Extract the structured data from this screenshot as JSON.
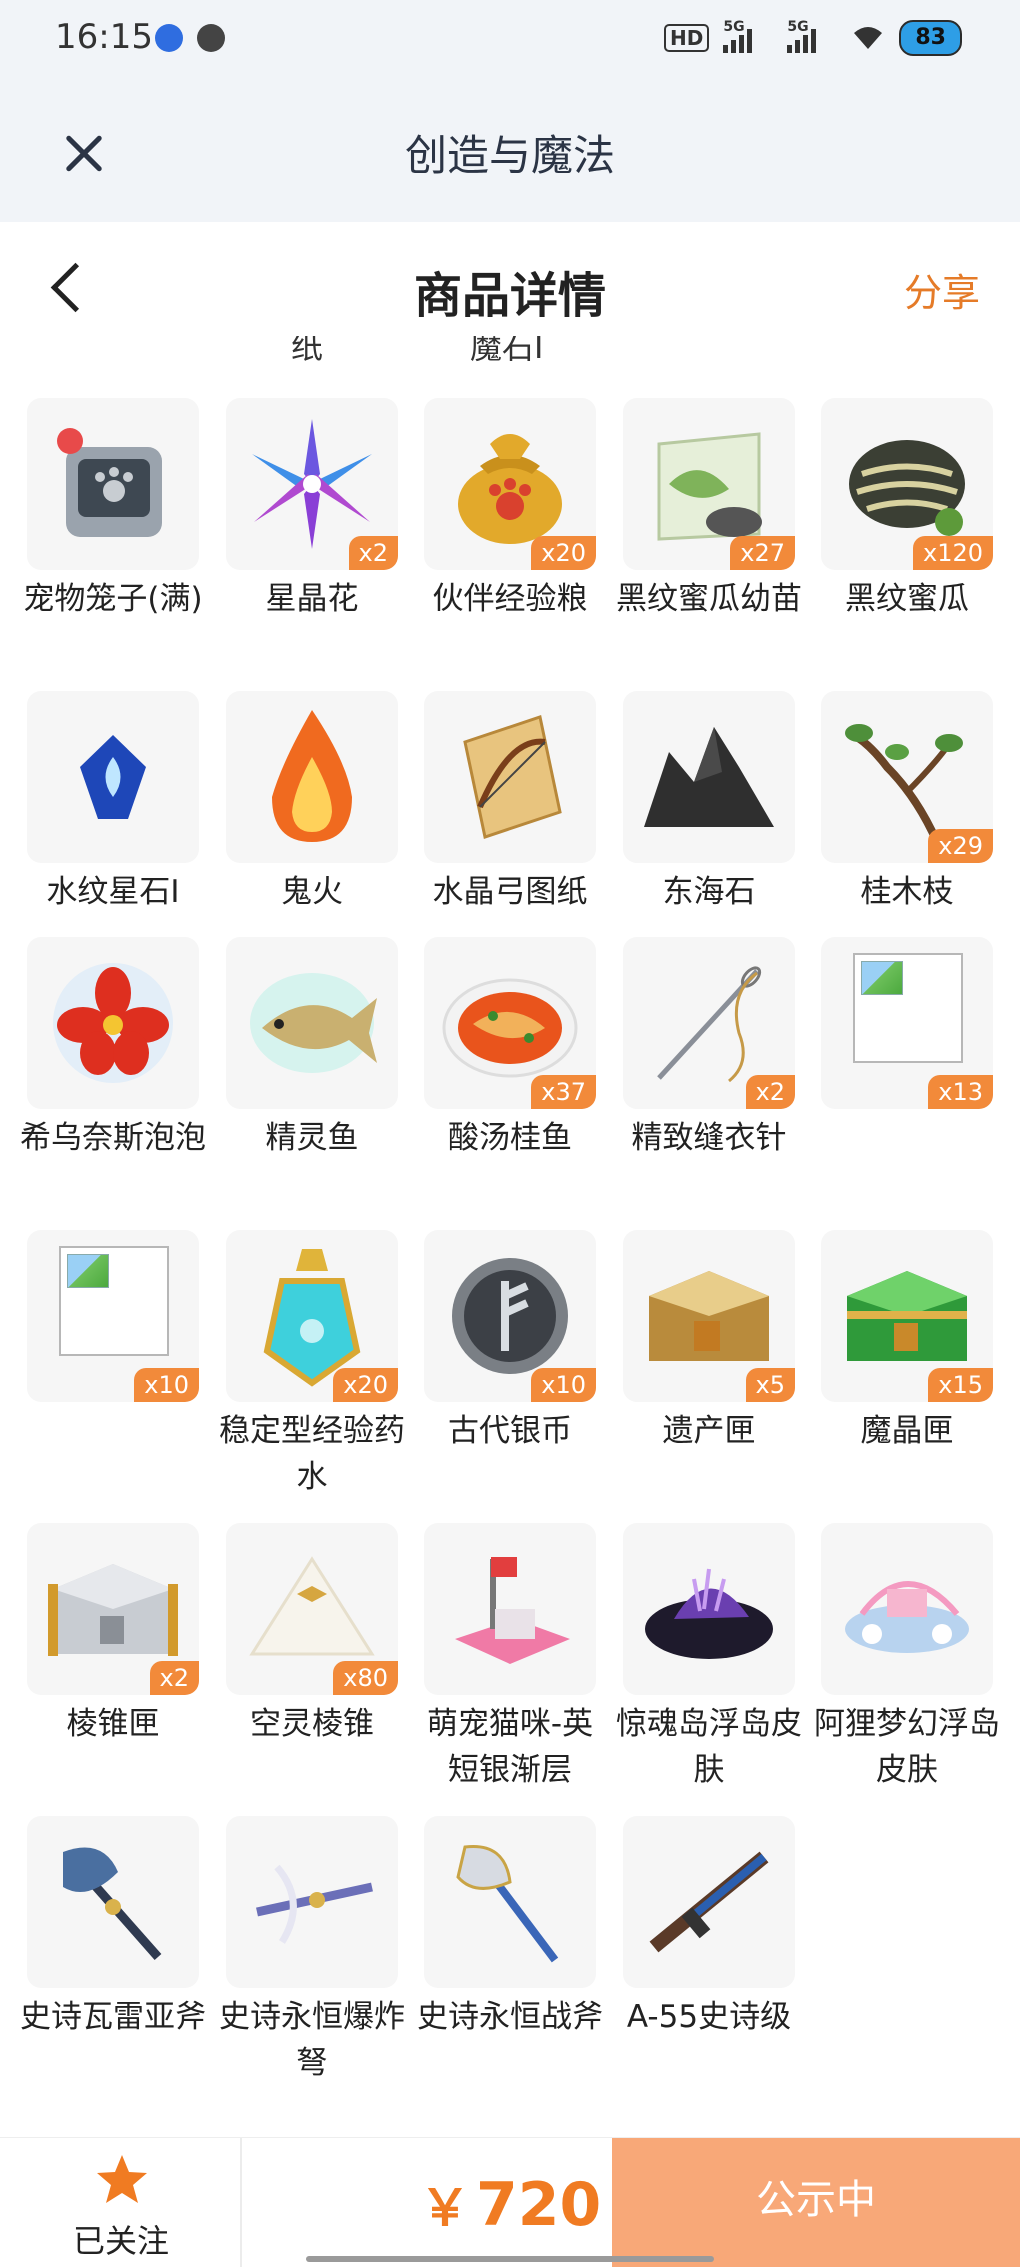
{
  "status_bar": {
    "time": "16:15",
    "hd": "HD",
    "signal1": "5G",
    "signal2": "5G",
    "battery": "83"
  },
  "mini_header": {
    "title": "创造与魔法"
  },
  "detail_header": {
    "title": "商品详情",
    "share": "分享"
  },
  "cut_labels": [
    "纸",
    "魔石I"
  ],
  "items": [
    {
      "name": "宠物笼子(满)",
      "count": "",
      "icon": "pet-cage-icon"
    },
    {
      "name": "星晶花",
      "count": "x2",
      "icon": "star-crystal-flower-icon"
    },
    {
      "name": "伙伴经验粮",
      "count": "x20",
      "icon": "exp-food-bag-icon"
    },
    {
      "name": "黑纹蜜瓜幼苗",
      "count": "x27",
      "icon": "melon-seed-pack-icon"
    },
    {
      "name": "黑纹蜜瓜",
      "count": "x120",
      "icon": "melon-icon"
    },
    {
      "name": "水纹星石I",
      "count": "",
      "icon": "water-star-stone-icon"
    },
    {
      "name": "鬼火",
      "count": "",
      "icon": "ghost-fire-icon"
    },
    {
      "name": "水晶弓图纸",
      "count": "",
      "icon": "bow-blueprint-icon"
    },
    {
      "name": "东海石",
      "count": "",
      "icon": "dark-rock-icon"
    },
    {
      "name": "桂木枝",
      "count": "x29",
      "icon": "branch-icon"
    },
    {
      "name": "希乌奈斯泡泡",
      "count": "",
      "icon": "red-flower-bubble-icon"
    },
    {
      "name": "精灵鱼",
      "count": "",
      "icon": "spirit-fish-icon"
    },
    {
      "name": "酸汤桂鱼",
      "count": "x37",
      "icon": "fish-soup-icon"
    },
    {
      "name": "精致缝衣针",
      "count": "x2",
      "icon": "needle-icon"
    },
    {
      "name": "",
      "count": "x13",
      "icon": "broken-image-icon"
    },
    {
      "name": "",
      "count": "x10",
      "icon": "broken-image-icon"
    },
    {
      "name": "稳定型经验药水",
      "count": "x20",
      "icon": "exp-potion-icon"
    },
    {
      "name": "古代银币",
      "count": "x10",
      "icon": "silver-coin-icon"
    },
    {
      "name": "遗产匣",
      "count": "x5",
      "icon": "gold-chest-icon"
    },
    {
      "name": "魔晶匣",
      "count": "x15",
      "icon": "green-chest-icon"
    },
    {
      "name": "棱锥匣",
      "count": "x2",
      "icon": "silver-chest-icon"
    },
    {
      "name": "空灵棱锥",
      "count": "x80",
      "icon": "pyramid-icon"
    },
    {
      "name": "萌宠猫咪-英短银渐层",
      "count": "",
      "icon": "cat-house-icon"
    },
    {
      "name": "惊魂岛浮岛皮肤",
      "count": "",
      "icon": "dark-island-icon"
    },
    {
      "name": "阿狸梦幻浮岛皮肤",
      "count": "",
      "icon": "dream-island-icon"
    },
    {
      "name": "史诗瓦雷亚斧",
      "count": "",
      "icon": "axe-icon"
    },
    {
      "name": "史诗永恒爆炸弩",
      "count": "",
      "icon": "crossbow-icon"
    },
    {
      "name": "史诗永恒战斧",
      "count": "",
      "icon": "battle-axe-icon"
    },
    {
      "name": "A-55史诗级",
      "count": "",
      "icon": "rifle-icon"
    }
  ],
  "bottom_bar": {
    "follow_label": "已关注",
    "currency": "￥",
    "price": "720",
    "action_label": "公示中"
  },
  "colors": {
    "accent": "#f07b22",
    "badge": "#f28a3a",
    "action_bg": "#f8a878"
  }
}
